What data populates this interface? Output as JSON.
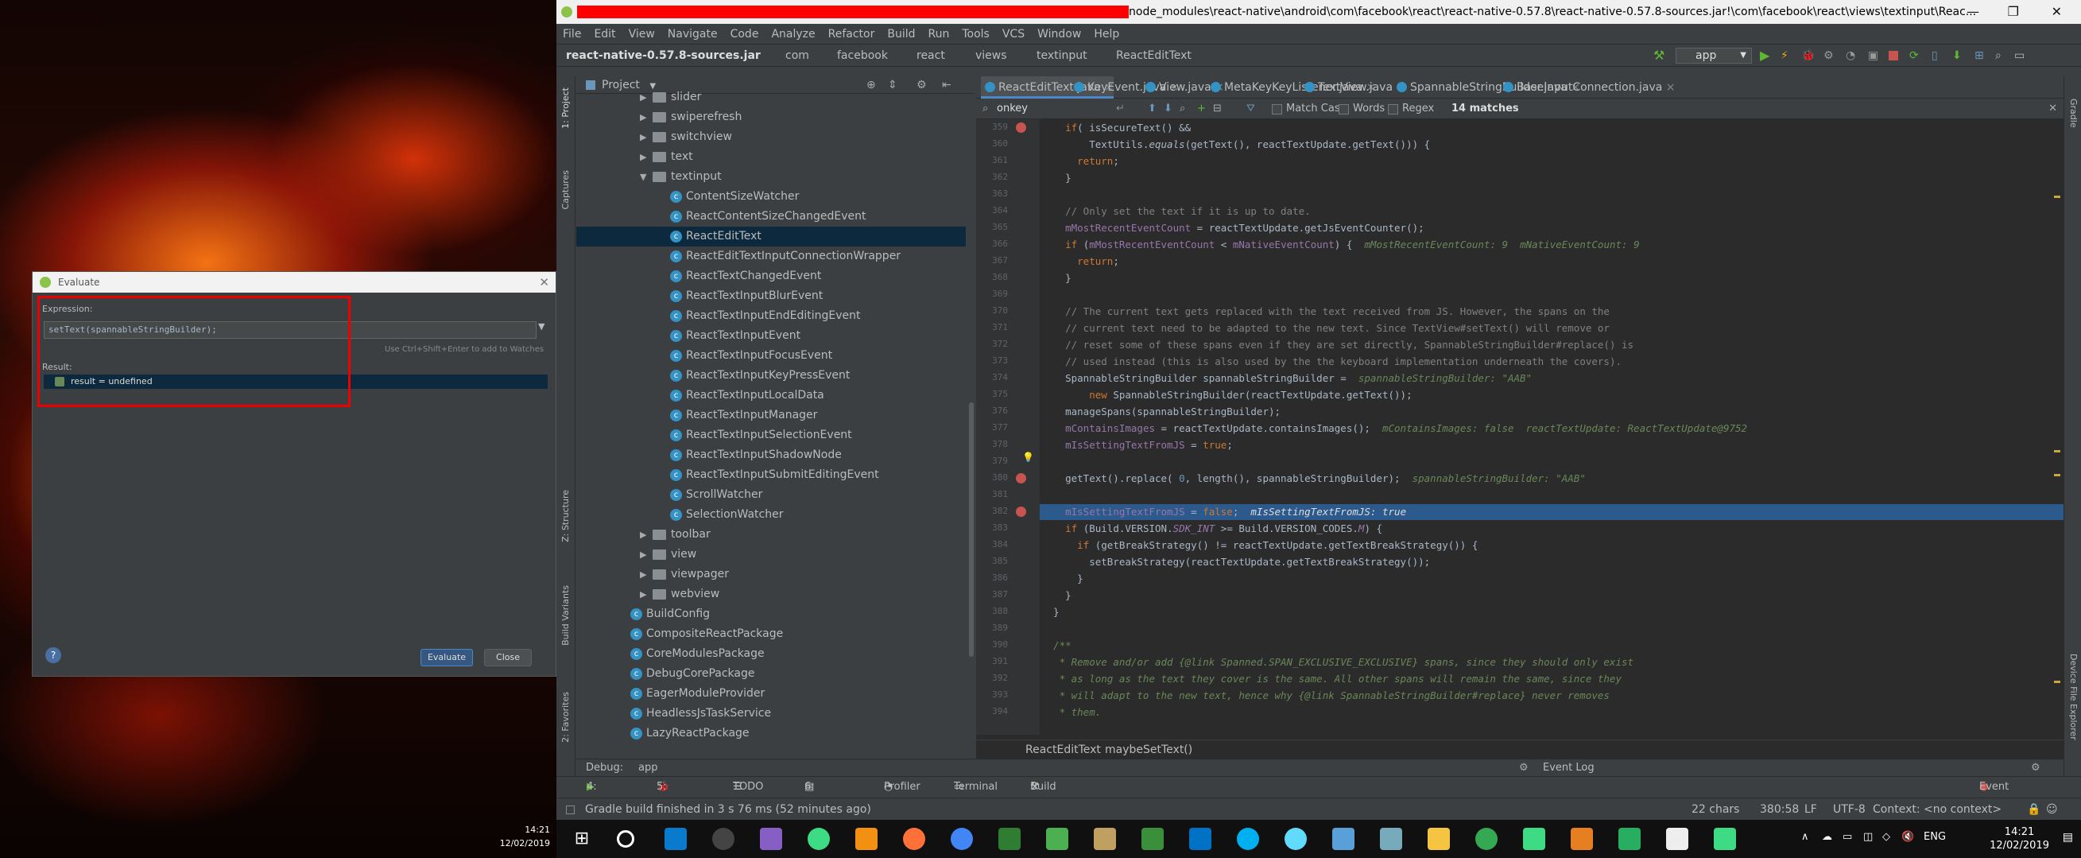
{
  "wallpaper_clock": {
    "time": "14:21",
    "date": "12/02/2019"
  },
  "evaluate": {
    "title": "Evaluate",
    "expression_label": "Expression:",
    "expression": "setText(spannableStringBuilder);",
    "hint": "Use Ctrl+Shift+Enter to add to Watches",
    "result_label": "Result:",
    "result": "result = undefined",
    "evaluate_button": "Evaluate",
    "close_button": "Close",
    "help": "?"
  },
  "ide": {
    "window_title": "node_modules\\react-native\\android\\com\\facebook\\react\\react-native-0.57.8\\react-native-0.57.8-sources.jar!\\com\\facebook\\react\\views\\textinput\\Reac...",
    "menu": [
      "File",
      "Edit",
      "View",
      "Navigate",
      "Code",
      "Analyze",
      "Refactor",
      "Build",
      "Run",
      "Tools",
      "VCS",
      "Window",
      "Help"
    ],
    "breadcrumbs": [
      "react-native-0.57.8-sources.jar",
      "com",
      "facebook",
      "react",
      "views",
      "textinput",
      "ReactEditText"
    ],
    "run_config": "app",
    "project_panel_title": "Project",
    "left_tabs": [
      "1: Project",
      "Captures",
      "Z: Structure",
      "Build Variants",
      "2: Favorites"
    ],
    "right_tabs": [
      "Gradle",
      "Device File Explorer"
    ],
    "tree": [
      {
        "label": "slider",
        "type": "folder",
        "indent": 0,
        "arrow": "▶"
      },
      {
        "label": "swiperefresh",
        "type": "folder",
        "indent": 0,
        "arrow": "▶"
      },
      {
        "label": "switchview",
        "type": "folder",
        "indent": 0,
        "arrow": "▶"
      },
      {
        "label": "text",
        "type": "folder",
        "indent": 0,
        "arrow": "▶"
      },
      {
        "label": "textinput",
        "type": "folder",
        "indent": 0,
        "arrow": "▼"
      },
      {
        "label": "ContentSizeWatcher",
        "type": "class",
        "indent": 1
      },
      {
        "label": "ReactContentSizeChangedEvent",
        "type": "class",
        "indent": 1
      },
      {
        "label": "ReactEditText",
        "type": "class",
        "indent": 1,
        "selected": true
      },
      {
        "label": "ReactEditTextInputConnectionWrapper",
        "type": "class",
        "indent": 1
      },
      {
        "label": "ReactTextChangedEvent",
        "type": "class",
        "indent": 1
      },
      {
        "label": "ReactTextInputBlurEvent",
        "type": "class",
        "indent": 1
      },
      {
        "label": "ReactTextInputEndEditingEvent",
        "type": "class",
        "indent": 1
      },
      {
        "label": "ReactTextInputEvent",
        "type": "class",
        "indent": 1
      },
      {
        "label": "ReactTextInputFocusEvent",
        "type": "class",
        "indent": 1
      },
      {
        "label": "ReactTextInputKeyPressEvent",
        "type": "class",
        "indent": 1
      },
      {
        "label": "ReactTextInputLocalData",
        "type": "class",
        "indent": 1
      },
      {
        "label": "ReactTextInputManager",
        "type": "class",
        "indent": 1
      },
      {
        "label": "ReactTextInputSelectionEvent",
        "type": "class",
        "indent": 1
      },
      {
        "label": "ReactTextInputShadowNode",
        "type": "class",
        "indent": 1
      },
      {
        "label": "ReactTextInputSubmitEditingEvent",
        "type": "class",
        "indent": 1
      },
      {
        "label": "ScrollWatcher",
        "type": "class",
        "indent": 1
      },
      {
        "label": "SelectionWatcher",
        "type": "class",
        "indent": 1
      },
      {
        "label": "toolbar",
        "type": "folder",
        "indent": 0,
        "arrow": "▶"
      },
      {
        "label": "view",
        "type": "folder",
        "indent": 0,
        "arrow": "▶"
      },
      {
        "label": "viewpager",
        "type": "folder",
        "indent": 0,
        "arrow": "▶"
      },
      {
        "label": "webview",
        "type": "folder",
        "indent": 0,
        "arrow": "▶"
      },
      {
        "label": "BuildConfig",
        "type": "class",
        "indent": -1
      },
      {
        "label": "CompositeReactPackage",
        "type": "class",
        "indent": -1
      },
      {
        "label": "CoreModulesPackage",
        "type": "class",
        "indent": -1
      },
      {
        "label": "DebugCorePackage",
        "type": "class",
        "indent": -1
      },
      {
        "label": "EagerModuleProvider",
        "type": "class",
        "indent": -1
      },
      {
        "label": "HeadlessJsTaskService",
        "type": "class",
        "indent": -1
      },
      {
        "label": "LazyReactPackage",
        "type": "class",
        "indent": -1
      }
    ],
    "tabs": [
      "ReactEditText.java",
      "KeyEvent.java",
      "View.java",
      "MetaKeyKeyListener.java",
      "TextView.java",
      "SpannableStringBuilder.java",
      "BaseInputConnection.java"
    ],
    "search": {
      "query": "onkey",
      "match_case": "Match Case",
      "words": "Words",
      "regex": "Regex",
      "matches": "14 matches"
    },
    "editor_breadcrumb": [
      "ReactEditText",
      "maybeSetText()"
    ],
    "bottom_tools": [
      "4: Run",
      "5: Debug",
      "TODO",
      "6: Logcat",
      "Profiler",
      "Terminal",
      "Build",
      "Event Log"
    ],
    "debug_tab": "Debug:",
    "debug_app": "app",
    "event_log": "Event Log",
    "status": {
      "message": "Gradle build finished in 3 s 76 ms (52 minutes ago)",
      "chars": "22 chars",
      "position": "380:58",
      "line_sep": "LF",
      "encoding": "UTF-8",
      "context": "Context: <no context>"
    }
  },
  "code_lines": [
    {
      "n": "359",
      "html": "    <span class='kw'>if</span>( isSecureText() &amp;&amp;"
    },
    {
      "n": "360",
      "html": "        TextUtils.<span class='it'>equals</span>(getText(), reactTextUpdate.getText())) {"
    },
    {
      "n": "361",
      "html": "      <span class='kw'>return</span>;"
    },
    {
      "n": "362",
      "html": "    }"
    },
    {
      "n": "363",
      "html": ""
    },
    {
      "n": "364",
      "html": "    <span class='cm'>// Only set the text if it is up to date.</span>"
    },
    {
      "n": "365",
      "html": "    <span class='fld'>mMostRecentEventCount</span> = reactTextUpdate.getJsEventCounter();"
    },
    {
      "n": "366",
      "html": "    <span class='kw'>if</span> (<span class='fld'>mMostRecentEventCount</span> &lt; <span class='fld'>mNativeEventCount</span>) {  <span class='dbg'>mMostRecentEventCount: 9  mNativeEventCount: 9</span>"
    },
    {
      "n": "367",
      "html": "      <span class='kw'>return</span>;"
    },
    {
      "n": "368",
      "html": "    }"
    },
    {
      "n": "369",
      "html": ""
    },
    {
      "n": "370",
      "html": "    <span class='cm'>// The current text gets replaced with the text received from JS. However, the spans on the</span>"
    },
    {
      "n": "371",
      "html": "    <span class='cm'>// current text need to be adapted to the new text. Since TextView#setText() will remove or</span>"
    },
    {
      "n": "372",
      "html": "    <span class='cm'>// reset some of these spans even if they are set directly, SpannableStringBuilder#replace() is</span>"
    },
    {
      "n": "373",
      "html": "    <span class='cm'>// used instead (this is also used by the the keyboard implementation underneath the covers).</span>"
    },
    {
      "n": "374",
      "html": "    SpannableStringBuilder spannableStringBuilder =  <span class='dbg'>spannableStringBuilder: \"AAB\"</span>"
    },
    {
      "n": "375",
      "html": "        <span class='kw'>new</span> SpannableStringBuilder(reactTextUpdate.getText());"
    },
    {
      "n": "376",
      "html": "    manageSpans(spannableStringBuilder);"
    },
    {
      "n": "377",
      "html": "    <span class='fld'>mContainsImages</span> = reactTextUpdate.containsImages();  <span class='dbg'>mContainsImages: false  reactTextUpdate: ReactTextUpdate@9752</span>"
    },
    {
      "n": "378",
      "html": "    <span class='fld'>mIsSettingTextFromJS</span> = <span class='kw'>true</span>;"
    },
    {
      "n": "379",
      "html": ""
    },
    {
      "n": "380",
      "html": "    getText().replace( <span class='num'>0</span>, length(), spannableStringBuilder);  <span class='dbg'>spannableStringBuilder: \"AAB\"</span>"
    },
    {
      "n": "381",
      "html": ""
    },
    {
      "n": "382",
      "html": "    <span class='fld'>mIsSettingTextFromJS</span> = <span class='kw'>false</span>;  <span class='dbg' style='color:#ddd'>mIsSettingTextFromJS: true</span>"
    },
    {
      "n": "383",
      "html": "    <span class='kw'>if</span> (Build.VERSION.<span class='fld it'>SDK_INT</span> &gt;= Build.VERSION_CODES.<span class='fld it'>M</span>) {"
    },
    {
      "n": "384",
      "html": "      <span class='kw'>if</span> (getBreakStrategy() != reactTextUpdate.getTextBreakStrategy()) {"
    },
    {
      "n": "385",
      "html": "        setBreakStrategy(reactTextUpdate.getTextBreakStrategy());"
    },
    {
      "n": "386",
      "html": "      }"
    },
    {
      "n": "387",
      "html": "    }"
    },
    {
      "n": "388",
      "html": "  }"
    },
    {
      "n": "389",
      "html": ""
    },
    {
      "n": "390",
      "html": "  <span class='str it'>/**</span>"
    },
    {
      "n": "391",
      "html": "<span class='str it'>   * Remove and/or add {@link Spanned.SPAN_EXCLUSIVE_EXCLUSIVE} spans, since they should only exist</span>"
    },
    {
      "n": "392",
      "html": "<span class='str it'>   * as long as the text they cover is the same. All other spans will remain the same, since they</span>"
    },
    {
      "n": "393",
      "html": "<span class='str it'>   * will adapt to the new text, hence why {@link SpannableStringBuilder#replace} never removes</span>"
    },
    {
      "n": "394",
      "html": "<span class='str it'>   * them.</span>"
    }
  ],
  "taskbar": {
    "time": "14:21",
    "date": "12/02/2019",
    "lang": "ENG"
  }
}
